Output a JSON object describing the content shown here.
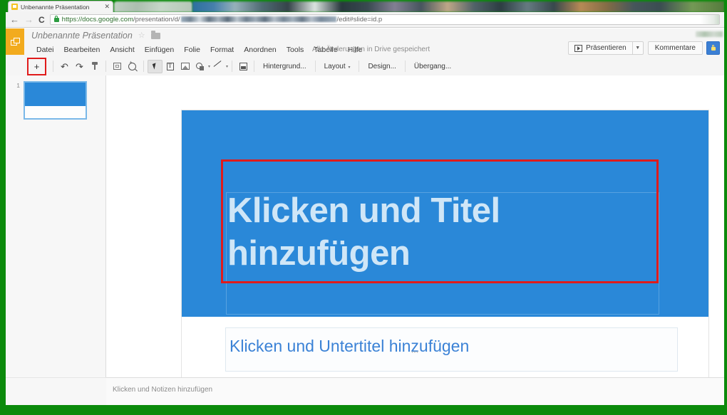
{
  "browser": {
    "tab": {
      "title": "Unbenannte Präsentation",
      "close_label": "✕",
      "favicon": "slides-favicon"
    },
    "nav": {
      "back": "←",
      "forward": "→",
      "reload": "C"
    },
    "url": {
      "domain": "https://docs.google.com",
      "path_start": "/presentation/d/",
      "path_end": "/edit#slide=id.p",
      "lock": "secure-lock-icon"
    }
  },
  "app": {
    "logo": "google-slides-logo",
    "doc_title": "Unbenannte Präsentation",
    "star": "☆",
    "folder": "folder-icon",
    "save_state": "Alle Änderungen in Drive gespeichert",
    "menus": [
      {
        "label": "Datei"
      },
      {
        "label": "Bearbeiten"
      },
      {
        "label": "Ansicht"
      },
      {
        "label": "Einfügen"
      },
      {
        "label": "Folie"
      },
      {
        "label": "Format"
      },
      {
        "label": "Anordnen"
      },
      {
        "label": "Tools"
      },
      {
        "label": "Tabelle"
      },
      {
        "label": "Hilfe"
      }
    ],
    "header_actions": {
      "present_label": "Präsentieren",
      "present_arrow": "▼",
      "comments_label": "Kommentare",
      "share_icon": "lock-icon"
    }
  },
  "toolbar": {
    "new_slide": {
      "label": "+",
      "name": "new-slide-button",
      "highlighted": true
    },
    "highlight_color": "#e01b1b",
    "undo": "↶",
    "redo": "↷",
    "paint_format": "paint-format-icon",
    "fit": "fit-to-screen-icon",
    "zoom": "zoom-icon",
    "select": "cursor-icon",
    "textbox": "T",
    "image": "image-icon",
    "shape": "shape-icon",
    "line": "line-icon",
    "comment": "comment-icon",
    "dropdown_arrow": "▾",
    "text_buttons": [
      {
        "label": "Hintergrund...",
        "name": "background-button"
      },
      {
        "label": "Layout",
        "name": "layout-button",
        "arrow": "▾"
      },
      {
        "label": "Design...",
        "name": "theme-button"
      },
      {
        "label": "Übergang...",
        "name": "transition-button"
      }
    ]
  },
  "filmstrip": {
    "slides": [
      {
        "number": "1",
        "selected": true
      }
    ]
  },
  "slide": {
    "title_placeholder": "Klicken und Titel hinzufügen",
    "subtitle_placeholder": "Klicken und Untertitel hinzufügen",
    "background_color": "#2a88d8",
    "title_color": "#cfe6f7",
    "subtitle_color": "#3b82d6"
  },
  "notes": {
    "placeholder": "Klicken und Notizen hinzufügen",
    "drag_handle": "•••"
  }
}
